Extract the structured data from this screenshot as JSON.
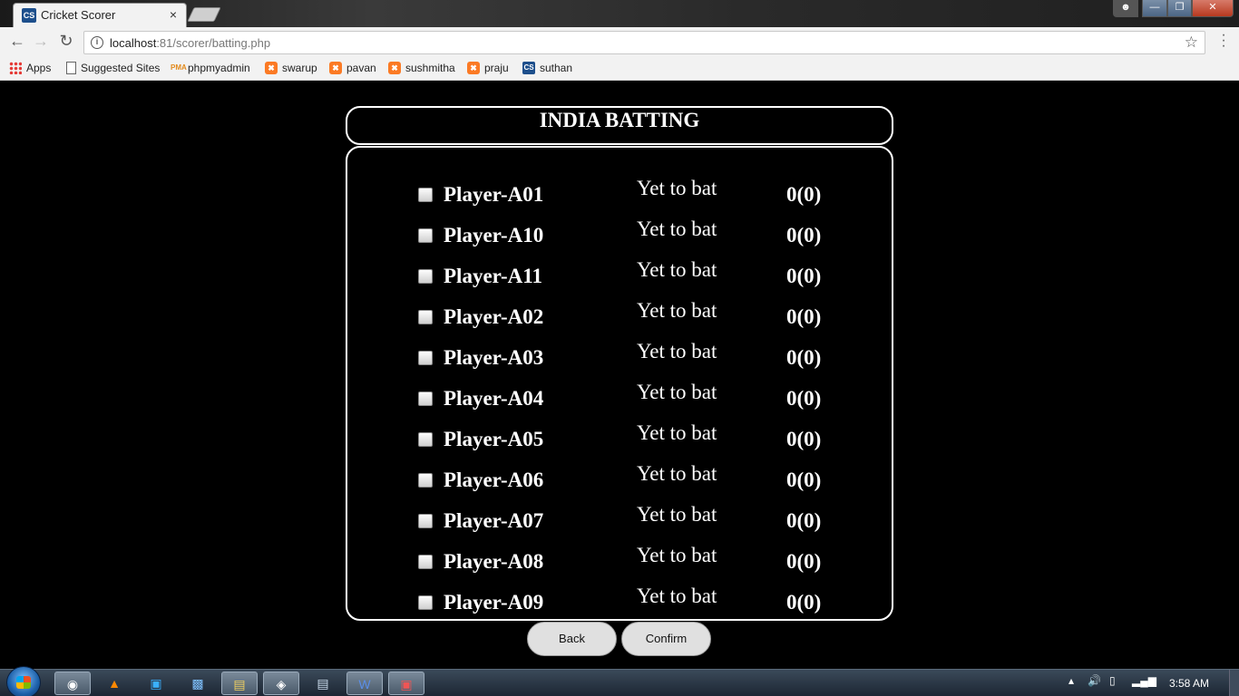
{
  "browser": {
    "tab_title": "Cricket Scorer",
    "tab_favicon": "CS",
    "tab_close": "×",
    "url_host": "localhost",
    "url_rest": ":81/scorer/batting.php",
    "bookmarks": [
      {
        "label": "Apps",
        "icon": "apps-icon"
      },
      {
        "label": "Suggested Sites",
        "icon": "page-icon"
      },
      {
        "label": "phpmyadmin",
        "icon": "phpmyadmin-icon"
      },
      {
        "label": "swarup",
        "icon": "xampp-icon"
      },
      {
        "label": "pavan",
        "icon": "xampp-icon"
      },
      {
        "label": "sushmitha",
        "icon": "xampp-icon"
      },
      {
        "label": "praju",
        "icon": "xampp-icon"
      },
      {
        "label": "suthan",
        "icon": "cs-icon"
      }
    ]
  },
  "page": {
    "title": "INDIA BATTING",
    "players": [
      {
        "name": "Player-A01",
        "status": "Yet to bat",
        "score": "0(0)"
      },
      {
        "name": "Player-A10",
        "status": "Yet to bat",
        "score": "0(0)"
      },
      {
        "name": "Player-A11",
        "status": "Yet to bat",
        "score": "0(0)"
      },
      {
        "name": "Player-A02",
        "status": "Yet to bat",
        "score": "0(0)"
      },
      {
        "name": "Player-A03",
        "status": "Yet to bat",
        "score": "0(0)"
      },
      {
        "name": "Player-A04",
        "status": "Yet to bat",
        "score": "0(0)"
      },
      {
        "name": "Player-A05",
        "status": "Yet to bat",
        "score": "0(0)"
      },
      {
        "name": "Player-A06",
        "status": "Yet to bat",
        "score": "0(0)"
      },
      {
        "name": "Player-A07",
        "status": "Yet to bat",
        "score": "0(0)"
      },
      {
        "name": "Player-A08",
        "status": "Yet to bat",
        "score": "0(0)"
      },
      {
        "name": "Player-A09",
        "status": "Yet to bat",
        "score": "0(0)"
      }
    ],
    "back_label": "Back",
    "confirm_label": "Confirm"
  },
  "taskbar": {
    "clock": "3:58 AM"
  },
  "colors": {
    "page_background": "#000000",
    "text": "#ffffff",
    "button_background": "#e0e0e0"
  }
}
